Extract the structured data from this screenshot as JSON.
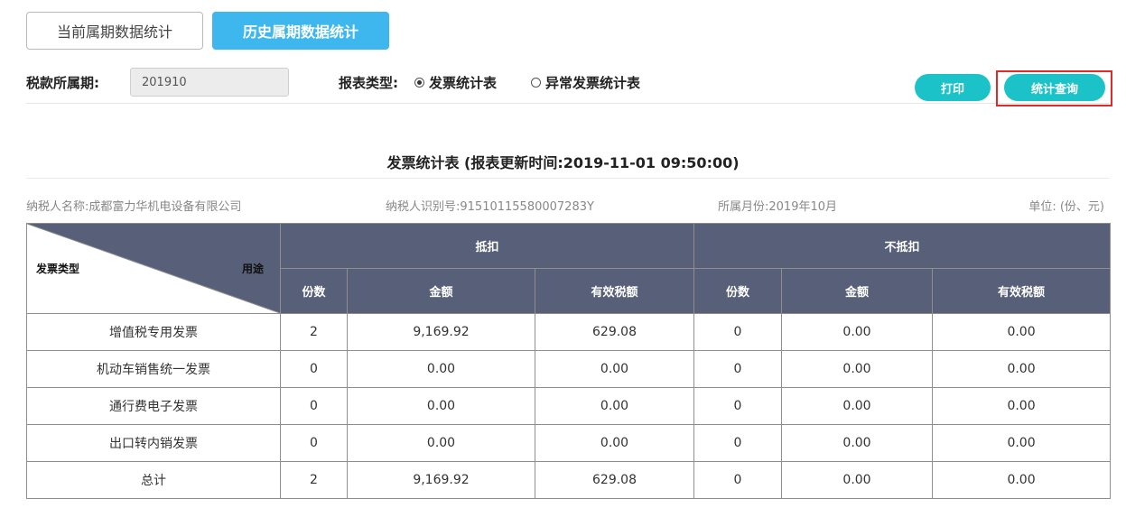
{
  "tabs": {
    "current": "当前属期数据统计",
    "history": "历史属期数据统计"
  },
  "filters": {
    "period_label": "税款所属期:",
    "period_value": "201910",
    "report_type_label": "报表类型:",
    "radio_invoice": "发票统计表",
    "radio_abnormal": "异常发票统计表"
  },
  "buttons": {
    "print": "打印",
    "query": "统计查询"
  },
  "report": {
    "title": "发票统计表 (报表更新时间:2019-11-01 09:50:00)",
    "taxpayer_name": "纳税人名称:成都富力华机电设备有限公司",
    "taxpayer_id": "纳税人识别号:91510115580007283Y",
    "month": "所属月份:2019年10月",
    "unit": "单位: (份、元)"
  },
  "table": {
    "corner_type": "发票类型",
    "corner_use": "用途",
    "group_deduct": "抵扣",
    "group_nondeduct": "不抵扣",
    "col_count": "份数",
    "col_amount": "金额",
    "col_tax": "有效税额",
    "rows": [
      {
        "name": "增值税专用发票",
        "d_count": "2",
        "d_amount": "9,169.92",
        "d_tax": "629.08",
        "n_count": "0",
        "n_amount": "0.00",
        "n_tax": "0.00"
      },
      {
        "name": "机动车销售统一发票",
        "d_count": "0",
        "d_amount": "0.00",
        "d_tax": "0.00",
        "n_count": "0",
        "n_amount": "0.00",
        "n_tax": "0.00"
      },
      {
        "name": "通行费电子发票",
        "d_count": "0",
        "d_amount": "0.00",
        "d_tax": "0.00",
        "n_count": "0",
        "n_amount": "0.00",
        "n_tax": "0.00"
      },
      {
        "name": "出口转内销发票",
        "d_count": "0",
        "d_amount": "0.00",
        "d_tax": "0.00",
        "n_count": "0",
        "n_amount": "0.00",
        "n_tax": "0.00"
      },
      {
        "name": "总计",
        "d_count": "2",
        "d_amount": "9,169.92",
        "d_tax": "629.08",
        "n_count": "0",
        "n_amount": "0.00",
        "n_tax": "0.00"
      }
    ]
  },
  "colors": {
    "tab_active": "#3eb6ee",
    "button": "#1bc3c8",
    "table_header": "#585f78",
    "highlight_frame": "#e02a2a"
  }
}
